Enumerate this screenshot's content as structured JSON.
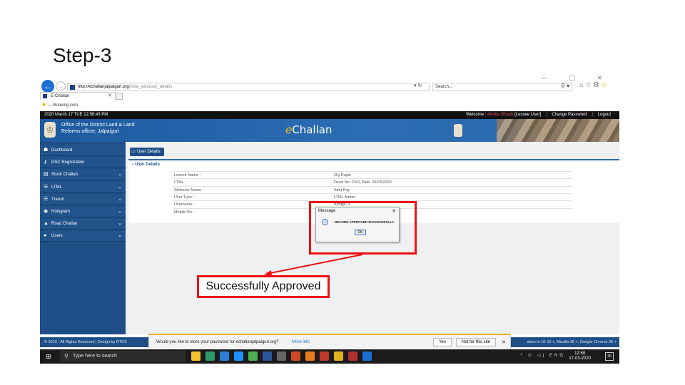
{
  "slide": {
    "title": "Step-3"
  },
  "browser": {
    "window_controls": "— ▢ ✕",
    "url_host": "http://echallanjalpaiguri.org",
    "url_path": "/view_webuser_details",
    "search_placeholder": "Search...",
    "tab_label": "E-Challan",
    "favorites_item": "Booking.com"
  },
  "site": {
    "datetime": "2020 March 17 TUE  12:58:43 PM",
    "welcome_prefix": "Welcome : ",
    "user_name": "Amrita Ghosh",
    "user_role": " [Lessee User]",
    "change_password": "Change Password",
    "logout": "Logout",
    "office_line1": "Office of the District Land & Land",
    "office_line2": "Reforms officer, Jalpaiguri",
    "brand_e": "e",
    "brand_rest": "Challan"
  },
  "sidebar": {
    "items": [
      {
        "label": "Dashboard",
        "icon": "tachometer-icon",
        "glyph": "☗",
        "chevron": ""
      },
      {
        "label": "DSC Registration",
        "icon": "key-icon",
        "glyph": "⚷",
        "chevron": ""
      },
      {
        "label": "Stock Challan",
        "icon": "doc-icon",
        "glyph": "▤",
        "chevron": "⌄"
      },
      {
        "label": "LTML",
        "icon": "list-icon",
        "glyph": "☰",
        "chevron": "⌄"
      },
      {
        "label": "Transit",
        "icon": "list-icon",
        "glyph": "☰",
        "chevron": "⌄"
      },
      {
        "label": "Hologram",
        "icon": "camera-icon",
        "glyph": "◉",
        "chevron": "⌄"
      },
      {
        "label": "Road Challan",
        "icon": "car-icon",
        "glyph": "▲",
        "chevron": "⌄"
      },
      {
        "label": "Users",
        "icon": "user-icon",
        "glyph": "●",
        "chevron": "⌄"
      }
    ]
  },
  "main": {
    "button_label": "User Details",
    "panel_heading": "User Details",
    "rows": [
      {
        "key": "Lessee Name :",
        "value": "Oly Rajak"
      },
      {
        "key": "LTML :",
        "value": "Deed No: 2342,Date: 26/03/2020"
      },
      {
        "key": "Webuser Name :",
        "value": "Amit Ray"
      },
      {
        "key": "User Type :",
        "value": "LTML Admin"
      },
      {
        "key": "Username :",
        "value": "Amitjpi73"
      },
      {
        "key": "Mobile No :",
        "value": ""
      }
    ]
  },
  "dialog": {
    "title": "Message",
    "message": "RECORD APPROVED SUCCESSFULLY.",
    "ok_label": "OK"
  },
  "footer": {
    "left": "© 2019 . All Rights Reserved | Design by RTCS",
    "right": "ation in I.E 10 +, Mozilla 35 +, Google Chrome 35 +"
  },
  "password_bar": {
    "question": "Would you like to store your password for echallanjalpaiguri.org?",
    "more_info": "More info",
    "yes": "Yes",
    "not_for_site": "Not for this site"
  },
  "taskbar": {
    "search_placeholder": "Type here to search",
    "language": "ENG",
    "time": "12:58",
    "date": "17-03-2020",
    "notifications": "30",
    "apps": [
      {
        "name": "file-explorer-icon",
        "color": "#f4c430"
      },
      {
        "name": "edge-icon",
        "color": "#2f9a6a"
      },
      {
        "name": "vscode-icon",
        "color": "#2a7fd4"
      },
      {
        "name": "app-icon",
        "color": "#1e90ff"
      },
      {
        "name": "app-green-icon",
        "color": "#4caf50"
      },
      {
        "name": "word-icon",
        "color": "#2b579a"
      },
      {
        "name": "settings-icon",
        "color": "#666666"
      },
      {
        "name": "powerpoint-icon",
        "color": "#d24726"
      },
      {
        "name": "app-orange-icon",
        "color": "#e87b1e"
      },
      {
        "name": "app-red-icon",
        "color": "#c0392b"
      },
      {
        "name": "chrome-icon",
        "color": "#e0b020"
      },
      {
        "name": "app-grid-icon",
        "color": "#b03030"
      },
      {
        "name": "ie-icon",
        "color": "#1d6fd1"
      }
    ]
  },
  "annotation": {
    "callout_text": "Successfully Approved",
    "accent": "#e11111"
  }
}
